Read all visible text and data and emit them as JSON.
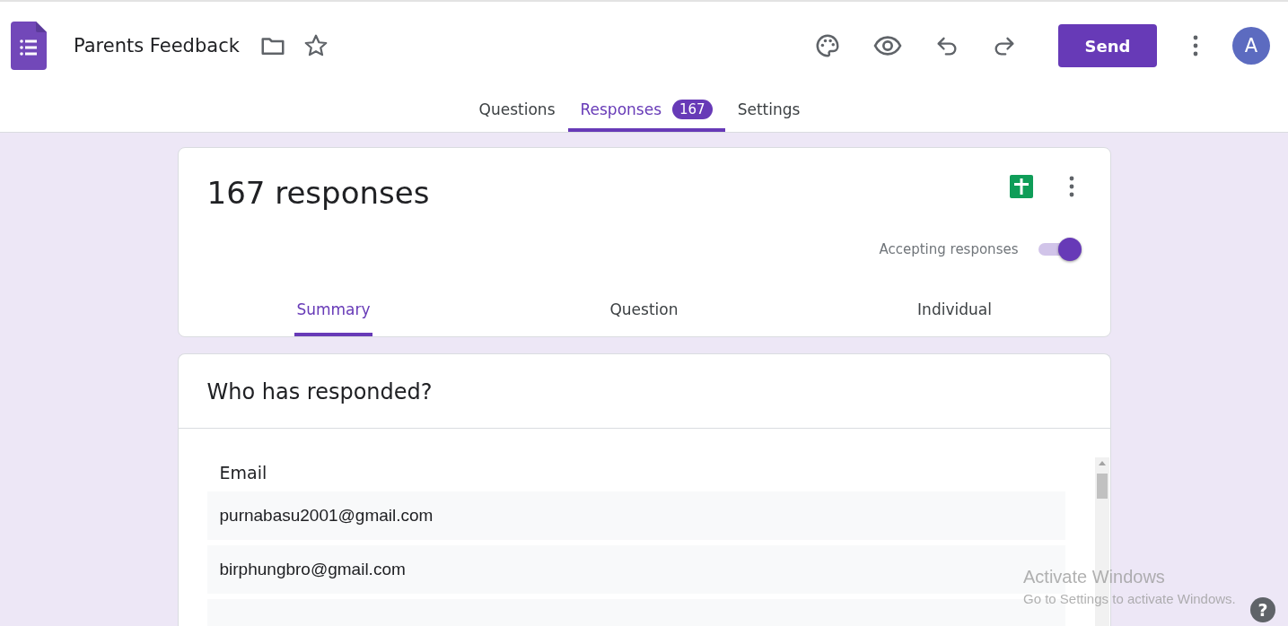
{
  "app": {
    "title": "Parents Feedback",
    "send_button": "Send",
    "avatar": "A"
  },
  "tabs": [
    {
      "label": "Questions",
      "selected": false
    },
    {
      "label": "Responses",
      "selected": true,
      "count": "167"
    },
    {
      "label": "Settings",
      "selected": false
    }
  ],
  "summary": {
    "heading": "167 responses",
    "accepting": {
      "label": "Accepting responses",
      "on": true
    },
    "view_tabs": [
      {
        "label": "Summary",
        "selected": true
      },
      {
        "label": "Question",
        "selected": false
      },
      {
        "label": "Individual",
        "selected": false
      }
    ]
  },
  "respondents": {
    "heading": "Who has responded?",
    "column": "Email",
    "rows": [
      "purnabasu2001@gmail.com",
      "birphungbro@gmail.com"
    ]
  },
  "help_button": "?",
  "os_notice": {
    "title": "Activate Windows",
    "message": "Go to Settings to activate Windows."
  }
}
